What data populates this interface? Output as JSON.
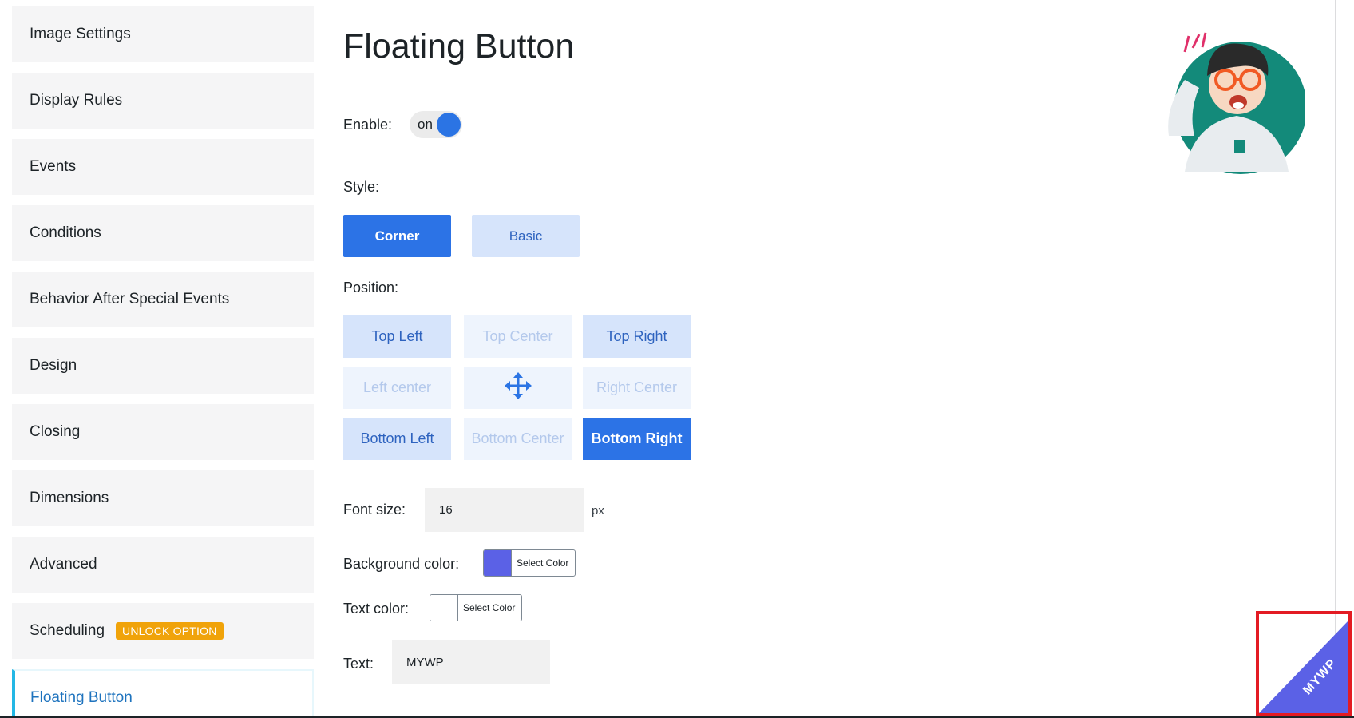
{
  "sidebar": {
    "items": [
      {
        "label": "Image Settings"
      },
      {
        "label": "Display Rules"
      },
      {
        "label": "Events"
      },
      {
        "label": "Conditions"
      },
      {
        "label": "Behavior After Special Events"
      },
      {
        "label": "Design"
      },
      {
        "label": "Closing"
      },
      {
        "label": "Dimensions"
      },
      {
        "label": "Advanced"
      },
      {
        "label": "Scheduling",
        "badge": "UNLOCK OPTION"
      },
      {
        "label": "Floating Button",
        "active": true
      }
    ]
  },
  "main": {
    "title": "Floating Button",
    "enable": {
      "label": "Enable:",
      "state": "on"
    },
    "style": {
      "label": "Style:",
      "options": [
        "Corner",
        "Basic"
      ],
      "selected": "Corner"
    },
    "position": {
      "label": "Position:",
      "grid": [
        [
          "Top Left",
          "Top Center",
          "Top Right"
        ],
        [
          "Left center",
          "move-arrows-icon",
          "Right Center"
        ],
        [
          "Bottom Left",
          "Bottom Center",
          "Bottom Right"
        ]
      ],
      "selected": "Bottom Right"
    },
    "font_size": {
      "label": "Font size:",
      "value": "16",
      "unit": "px"
    },
    "background_color": {
      "label": "Background color:",
      "button": "Select Color",
      "color": "#5b61e6"
    },
    "text_color": {
      "label": "Text color:",
      "button": "Select Color",
      "color": "#ffffff"
    },
    "text": {
      "label": "Text:",
      "value": "MYWP"
    }
  },
  "preview": {
    "corner_text": "MYWP",
    "corner_color": "#5b61e6"
  },
  "colors": {
    "accent": "#2c73e6",
    "highlight": "#e31b23",
    "badge": "#f0a30a",
    "active_sidebar": "#1e73be"
  }
}
